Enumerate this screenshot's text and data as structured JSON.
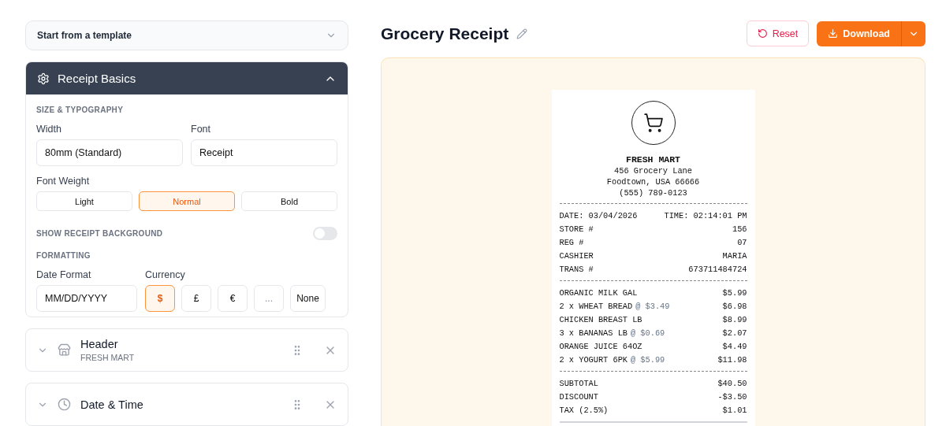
{
  "template_picker": {
    "label": "Start from a template",
    "expanded": false
  },
  "basics": {
    "title": "Receipt Basics",
    "expanded": true,
    "size_heading": "SIZE & TYPOGRAPHY",
    "width": {
      "label": "Width",
      "value": "80mm (Standard)"
    },
    "font": {
      "label": "Font",
      "value": "Receipt"
    },
    "font_weight": {
      "label": "Font Weight",
      "options": [
        {
          "label": "Light",
          "selected": false
        },
        {
          "label": "Normal",
          "selected": true
        },
        {
          "label": "Bold",
          "selected": false
        }
      ]
    },
    "background_toggle": {
      "label": "SHOW RECEIPT BACKGROUND",
      "on": false
    },
    "formatting_heading": "FORMATTING",
    "date_format": {
      "label": "Date Format",
      "value": "MM/DD/YYYY"
    },
    "currency": {
      "label": "Currency",
      "options": [
        {
          "label": "$",
          "selected": true,
          "disabled": false
        },
        {
          "label": "£",
          "selected": false,
          "disabled": false
        },
        {
          "label": "€",
          "selected": false,
          "disabled": false
        },
        {
          "label": "...",
          "selected": false,
          "disabled": true
        },
        {
          "label": "None",
          "selected": false,
          "disabled": false
        }
      ]
    }
  },
  "sections": [
    {
      "title": "Header",
      "subtitle": "FRESH MART",
      "kind": "store",
      "expanded": false
    },
    {
      "title": "Date & Time",
      "kind": "clock",
      "expanded": false
    }
  ],
  "document": {
    "title": "Grocery Receipt"
  },
  "actions": {
    "reset": "Reset",
    "download": "Download"
  },
  "receipt": {
    "store": "FRESH MART",
    "address": [
      "456 Grocery Lane",
      "Foodtown, USA 66666",
      "(555) 789-0123"
    ],
    "date": "DATE: 03/04/2026",
    "time": "TIME: 02:14:01 PM",
    "info": [
      {
        "label": "STORE #",
        "value": "156"
      },
      {
        "label": "REG #",
        "value": "07"
      },
      {
        "label": "CASHIER",
        "value": "MARIA"
      },
      {
        "label": "TRANS #",
        "value": "673711484724"
      }
    ],
    "items": [
      {
        "label": "ORGANIC MILK GAL",
        "amount": "$5.99"
      },
      {
        "label": "2 x WHEAT BREAD",
        "unit": "@ $3.49",
        "amount": "$6.98"
      },
      {
        "label": "CHICKEN BREAST LB",
        "amount": "$8.99"
      },
      {
        "label": "3 x BANANAS LB",
        "unit": "@ $0.69",
        "amount": "$2.07"
      },
      {
        "label": "ORANGE JUICE 64OZ",
        "amount": "$4.49"
      },
      {
        "label": "2 x YOGURT 6PK",
        "unit": "@ $5.99",
        "amount": "$11.98"
      }
    ],
    "totals": [
      {
        "label": "SUBTOTAL",
        "value": "$40.50"
      },
      {
        "label": "DISCOUNT",
        "value": "-$3.50"
      },
      {
        "label": "TAX (2.5%)",
        "value": "$1.01"
      }
    ]
  }
}
